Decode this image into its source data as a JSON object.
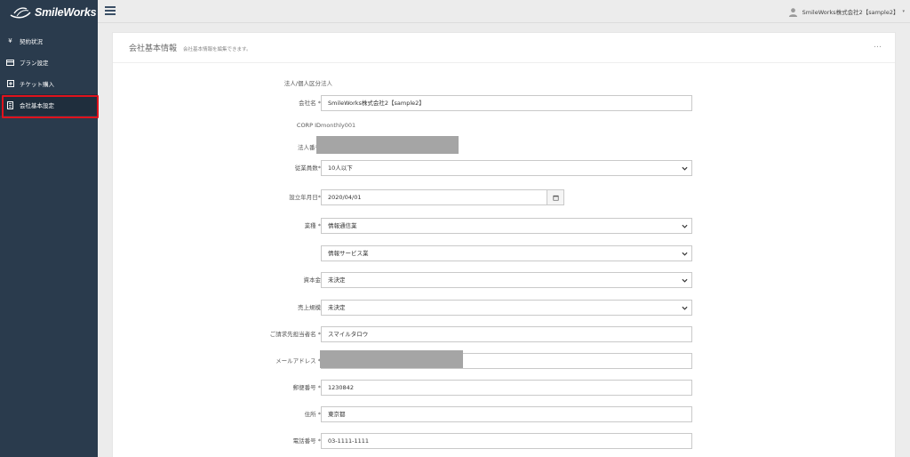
{
  "brand": {
    "name": "SmileWorks"
  },
  "sidebar": {
    "items": [
      {
        "label": "契約状況",
        "icon": "yen-icon"
      },
      {
        "label": "プラン設定",
        "icon": "card-icon"
      },
      {
        "label": "チケット購入",
        "icon": "plus-box-icon"
      },
      {
        "label": "会社基本設定",
        "icon": "building-icon",
        "active": true
      }
    ]
  },
  "topbar": {
    "user_name": "SmileWorks株式会社2【sample2】"
  },
  "panel": {
    "title": "会社基本情報",
    "subtitle": "会社基本情報を編集できます。",
    "more": "…"
  },
  "form": {
    "corp_type": {
      "label": "法人/個人区分",
      "value": "法人"
    },
    "company_name": {
      "label": "会社名 *",
      "value": "SmileWorks株式会社2【sample2】"
    },
    "corp_id": {
      "label": "CORP ID",
      "value": "monthly001"
    },
    "corp_number": {
      "label": "法人番号"
    },
    "employees": {
      "label": "従業員数*",
      "value": "10人以下"
    },
    "founded": {
      "label": "設立年月日*",
      "value": "2020/04/01"
    },
    "industry": {
      "label": "業種 *",
      "value": "情報通信業",
      "sub_value": "情報サービス業"
    },
    "capital": {
      "label": "資本金",
      "value": "未決定"
    },
    "sales": {
      "label": "売上規模",
      "value": "未決定"
    },
    "billing_contact": {
      "label": "ご請求先担当者名 *",
      "value": "スマイルタロウ"
    },
    "email": {
      "label": "メールアドレス *"
    },
    "postal": {
      "label": "郵便番号 *",
      "value": "1230842"
    },
    "address": {
      "label": "住所 *",
      "value": "東京都"
    },
    "phone": {
      "label": "電話番号 *",
      "value": "03-1111-1111"
    }
  },
  "colors": {
    "sidebar": "#2a3b4d",
    "highlight": "#e0121c",
    "redaction": "#a5a5a5"
  }
}
